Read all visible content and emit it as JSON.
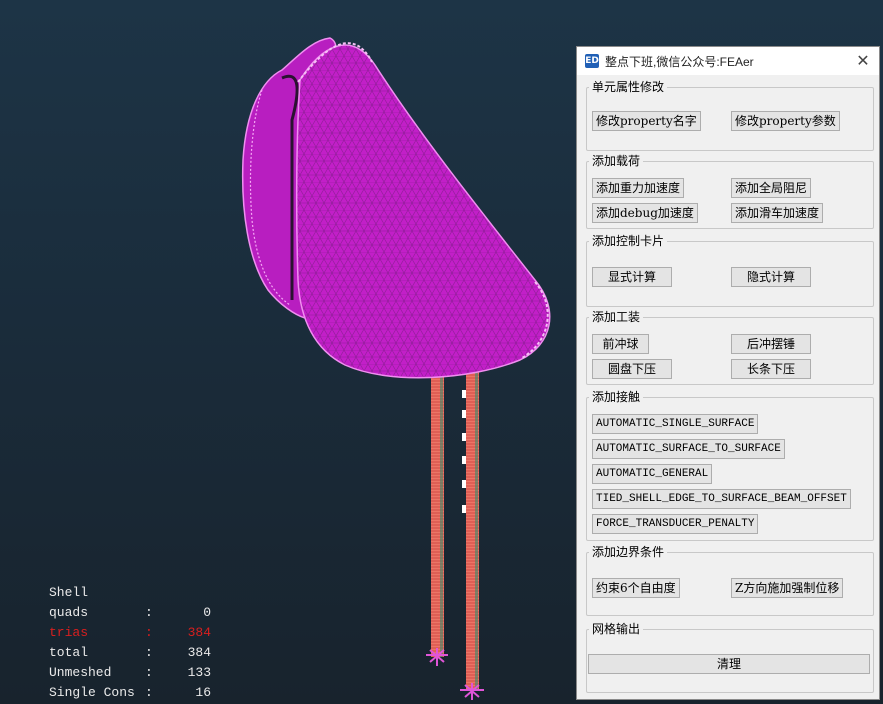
{
  "stats": {
    "header": "Shell",
    "rows": [
      {
        "label": "quads",
        "colon": ":",
        "value": "0"
      },
      {
        "label": "trias",
        "colon": ":",
        "value": "384"
      },
      {
        "label": "total",
        "colon": ":",
        "value": "384"
      },
      {
        "label": "Unmeshed",
        "colon": ":",
        "value": "133"
      },
      {
        "label": "Single Cons",
        "colon": ":",
        "value": "16"
      }
    ]
  },
  "dialog": {
    "app_icon": "ED",
    "title": "整点下班,微信公众号:FEAer",
    "close_icon": "✕",
    "groups": [
      {
        "title": "单元属性修改",
        "buttons": [
          "修改property名字",
          "修改property参数"
        ]
      },
      {
        "title": "添加载荷",
        "buttons": [
          "添加重力加速度",
          "添加全局阻尼",
          "添加debug加速度",
          "添加滑车加速度"
        ]
      },
      {
        "title": "添加控制卡片",
        "buttons": [
          "显式计算",
          "隐式计算"
        ]
      },
      {
        "title": "添加工装",
        "buttons": [
          "前冲球",
          "后冲摆锤",
          "圆盘下压",
          "长条下压"
        ]
      },
      {
        "title": "添加接触",
        "buttons": [
          "AUTOMATIC_SINGLE_SURFACE",
          "AUTOMATIC_SURFACE_TO_SURFACE",
          "AUTOMATIC_GENERAL",
          "TIED_SHELL_EDGE_TO_SURFACE_BEAM_OFFSET",
          "FORCE_TRANSDUCER_PENALTY"
        ]
      },
      {
        "title": "添加边界条件",
        "buttons": [
          "约束6个自由度",
          "Z方向施加强制位移"
        ]
      },
      {
        "title": "网格输出",
        "buttons": [
          "清理"
        ]
      }
    ]
  },
  "colors": {
    "mesh": "#c21fc8",
    "mesh_light": "#d83ee0",
    "rod": "#e0604f",
    "highlight_text": "#d81f1f"
  }
}
